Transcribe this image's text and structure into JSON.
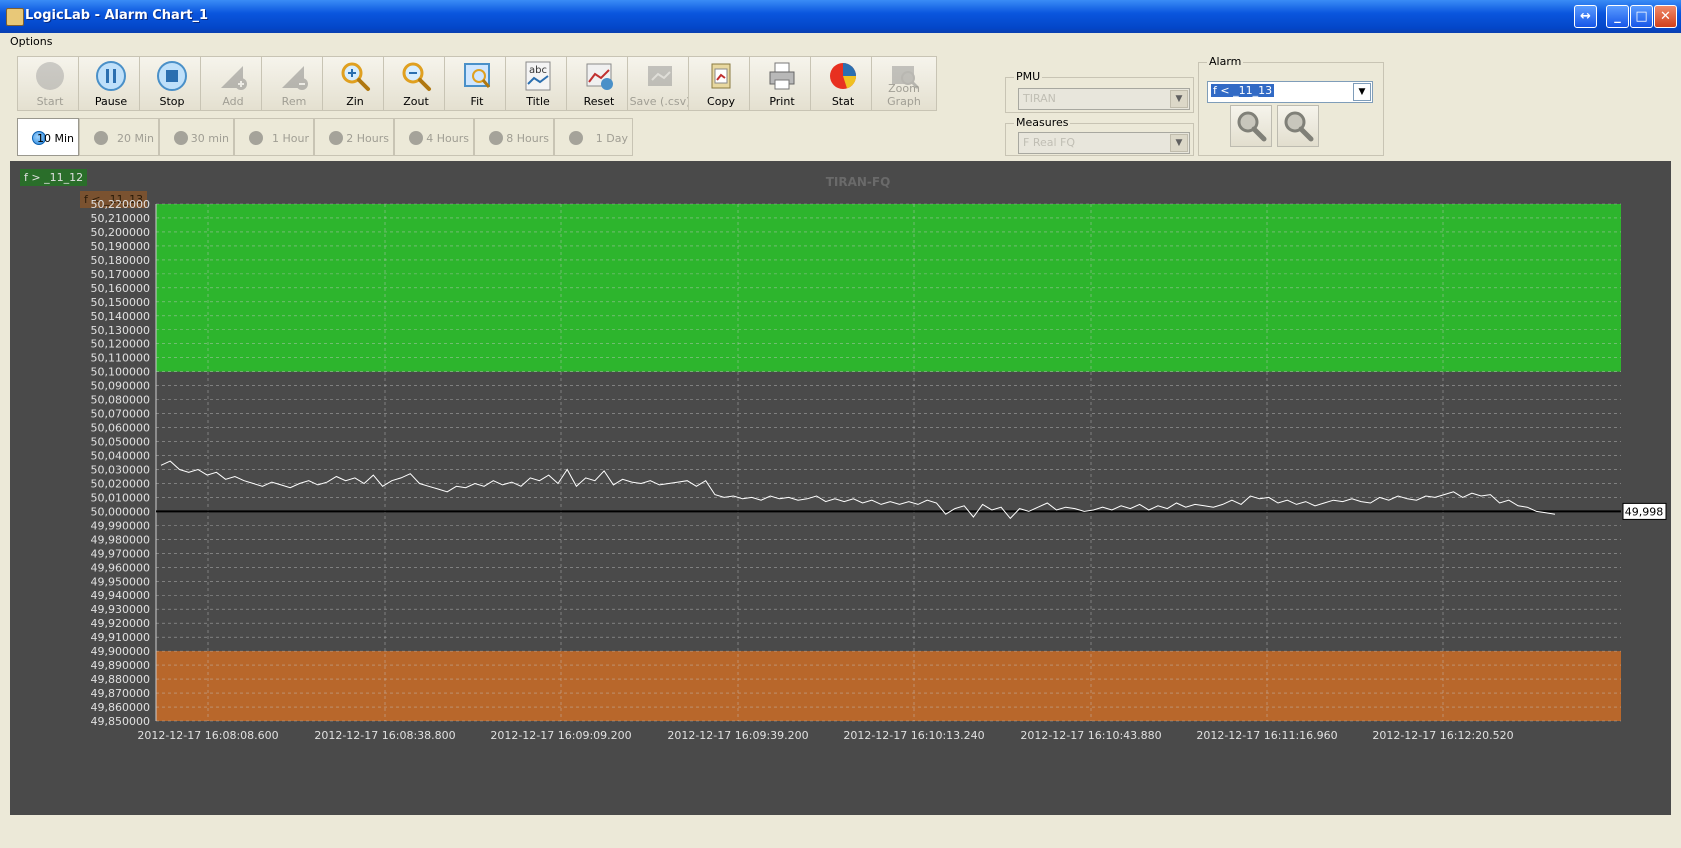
{
  "window": {
    "title": "LogicLab - Alarm Chart_1"
  },
  "menu": {
    "items": [
      "Options"
    ]
  },
  "toolbar": {
    "buttons": [
      {
        "label": "Start",
        "icon": "start-icon",
        "enabled": false
      },
      {
        "label": "Pause",
        "icon": "pause-icon",
        "enabled": true
      },
      {
        "label": "Stop",
        "icon": "stop-icon",
        "enabled": true
      },
      {
        "label": "Add",
        "icon": "add-icon",
        "enabled": false
      },
      {
        "label": "Rem",
        "icon": "remove-icon",
        "enabled": false
      },
      {
        "label": "Zin",
        "icon": "zoom-in-icon",
        "enabled": true
      },
      {
        "label": "Zout",
        "icon": "zoom-out-icon",
        "enabled": true
      },
      {
        "label": "Fit",
        "icon": "fit-icon",
        "enabled": true
      },
      {
        "label": "Title",
        "icon": "title-icon",
        "enabled": true
      },
      {
        "label": "Reset",
        "icon": "reset-icon",
        "enabled": true
      },
      {
        "label": "Save (.csv)",
        "icon": "save-csv-icon",
        "enabled": false
      },
      {
        "label": "Copy",
        "icon": "copy-icon",
        "enabled": true
      },
      {
        "label": "Print",
        "icon": "print-icon",
        "enabled": true
      },
      {
        "label": "Stat",
        "icon": "stat-pie-icon",
        "enabled": true
      },
      {
        "label": "Zoom Graph",
        "icon": "zoom-graph-icon",
        "enabled": false
      }
    ]
  },
  "timerange": {
    "options": [
      "10 Min",
      "20 Min",
      "30 min",
      "1 Hour",
      "2 Hours",
      "4 Hours",
      "8 Hours",
      "1 Day"
    ],
    "selected": "10 Min"
  },
  "pmu": {
    "label": "PMU",
    "value": "TIRAN"
  },
  "measures": {
    "label": "Measures",
    "value": "F Real FQ"
  },
  "alarm": {
    "label": "Alarm",
    "value": "f < _11_13"
  },
  "colors": {
    "upper_band": "#2db52d",
    "lower_band": "#b8672b",
    "plot_bg": "#4a4a4a",
    "line": "#ffffff"
  },
  "chart_data": {
    "type": "line",
    "title": "TIRAN-FQ",
    "legend": [
      {
        "label": "f > _11_12",
        "color": "#2a6e2a"
      },
      {
        "label": "f < _11_13",
        "color": "#7a5230"
      }
    ],
    "ylim": [
      49.85,
      50.22
    ],
    "yticks": [
      "50,220000",
      "50,210000",
      "50,200000",
      "50,190000",
      "50,180000",
      "50,170000",
      "50,160000",
      "50,150000",
      "50,140000",
      "50,130000",
      "50,120000",
      "50,110000",
      "50,100000",
      "50,090000",
      "50,080000",
      "50,070000",
      "50,060000",
      "50,050000",
      "50,040000",
      "50,030000",
      "50,020000",
      "50,010000",
      "50,000000",
      "49,990000",
      "49,980000",
      "49,970000",
      "49,960000",
      "49,950000",
      "49,940000",
      "49,930000",
      "49,920000",
      "49,910000",
      "49,900000",
      "49,890000",
      "49,880000",
      "49,870000",
      "49,860000",
      "49,850000"
    ],
    "xticks": [
      "2012-12-17 16:08:08.600",
      "2012-12-17 16:08:38.800",
      "2012-12-17 16:09:09.200",
      "2012-12-17 16:09:39.200",
      "2012-12-17 16:10:13.240",
      "2012-12-17 16:10:43.880",
      "2012-12-17 16:11:16.960",
      "2012-12-17 16:12:20.520"
    ],
    "bands": [
      {
        "name": "f > _11_12",
        "from": 50.1,
        "to": 50.22
      },
      {
        "name": "f < _11_13",
        "from": 49.85,
        "to": 49.9
      }
    ],
    "reference_line": {
      "value": 50.0,
      "label": "49,998"
    },
    "series": [
      {
        "values": [
          50.033,
          50.036,
          50.03,
          50.028,
          50.03,
          50.026,
          50.028,
          50.023,
          50.025,
          50.022,
          50.02,
          50.018,
          50.021,
          50.019,
          50.017,
          50.02,
          50.022,
          50.019,
          50.021,
          50.025,
          50.022,
          50.024,
          50.02,
          50.026,
          50.018,
          50.022,
          50.024,
          50.027,
          50.02,
          50.018,
          50.016,
          50.014,
          50.018,
          50.017,
          50.02,
          50.018,
          50.022,
          50.019,
          50.021,
          50.018,
          50.024,
          50.022,
          50.026,
          50.02,
          50.03,
          50.018,
          50.024,
          50.022,
          50.029,
          50.019,
          50.023,
          50.021,
          50.02,
          50.022,
          50.019,
          50.02,
          50.021,
          50.022,
          50.018,
          50.022,
          50.012,
          50.01,
          50.011,
          50.009,
          50.01,
          50.008,
          50.011,
          50.009,
          50.01,
          50.008,
          50.009,
          50.011,
          50.007,
          50.009,
          50.007,
          50.009,
          50.006,
          50.008,
          50.005,
          50.007,
          50.005,
          50.007,
          50.005,
          50.008,
          50.006,
          49.998,
          50.002,
          50.004,
          49.996,
          50.005,
          50.001,
          50.003,
          49.995,
          50.002,
          50.0,
          50.003,
          50.006,
          50.001,
          50.003,
          50.002,
          50.0,
          50.001,
          50.003,
          50.001,
          50.004,
          50.002,
          50.005,
          50.001,
          50.004,
          50.002,
          50.006,
          50.003,
          50.005,
          50.004,
          50.003,
          50.005,
          50.008,
          50.005,
          50.011,
          50.009,
          50.01,
          50.006,
          50.008,
          50.005,
          50.007,
          50.004,
          50.006,
          50.008,
          50.007,
          50.009,
          50.007,
          50.006,
          50.01,
          50.008,
          50.011,
          50.009,
          50.008,
          50.011,
          50.01,
          50.012,
          50.014,
          50.01,
          50.013,
          50.011,
          50.012,
          50.006,
          50.008,
          50.004,
          50.003,
          50.0,
          49.999,
          49.998
        ]
      }
    ]
  }
}
